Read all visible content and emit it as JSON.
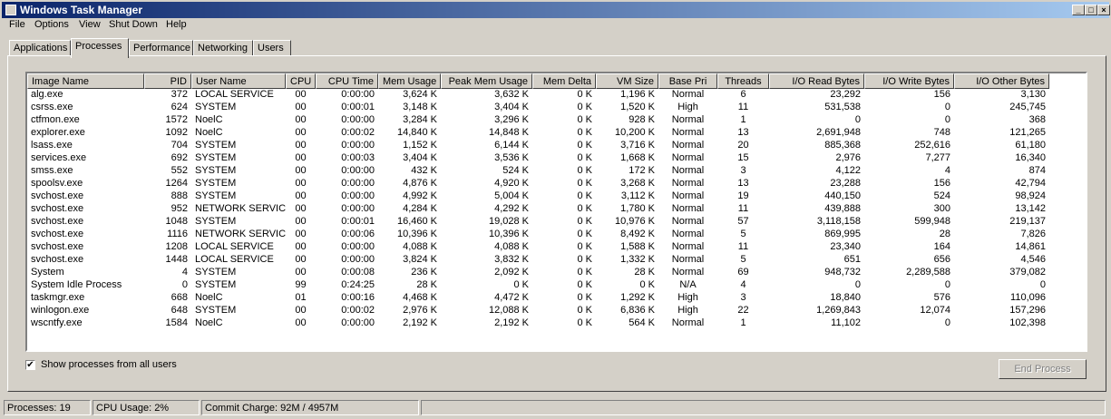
{
  "window": {
    "title": "Windows Task Manager"
  },
  "menu": [
    "File",
    "Options",
    "View",
    "Shut Down",
    "Help"
  ],
  "tabs": [
    "Applications",
    "Processes",
    "Performance",
    "Networking",
    "Users"
  ],
  "active_tab": "Processes",
  "columns": [
    "Image Name",
    "PID",
    "User Name",
    "CPU",
    "CPU Time",
    "Mem Usage",
    "Peak Mem Usage",
    "Mem Delta",
    "VM Size",
    "Base Pri",
    "Threads",
    "I/O Read Bytes",
    "I/O Write Bytes",
    "I/O Other Bytes"
  ],
  "processes": [
    [
      "alg.exe",
      "372",
      "LOCAL SERVICE",
      "00",
      "0:00:00",
      "3,624 K",
      "3,632 K",
      "0 K",
      "1,196 K",
      "Normal",
      "6",
      "23,292",
      "156",
      "3,130"
    ],
    [
      "csrss.exe",
      "624",
      "SYSTEM",
      "00",
      "0:00:01",
      "3,148 K",
      "3,404 K",
      "0 K",
      "1,520 K",
      "High",
      "11",
      "531,538",
      "0",
      "245,745"
    ],
    [
      "ctfmon.exe",
      "1572",
      "NoelC",
      "00",
      "0:00:00",
      "3,284 K",
      "3,296 K",
      "0 K",
      "928 K",
      "Normal",
      "1",
      "0",
      "0",
      "368"
    ],
    [
      "explorer.exe",
      "1092",
      "NoelC",
      "00",
      "0:00:02",
      "14,840 K",
      "14,848 K",
      "0 K",
      "10,200 K",
      "Normal",
      "13",
      "2,691,948",
      "748",
      "121,265"
    ],
    [
      "lsass.exe",
      "704",
      "SYSTEM",
      "00",
      "0:00:00",
      "1,152 K",
      "6,144 K",
      "0 K",
      "3,716 K",
      "Normal",
      "20",
      "885,368",
      "252,616",
      "61,180"
    ],
    [
      "services.exe",
      "692",
      "SYSTEM",
      "00",
      "0:00:03",
      "3,404 K",
      "3,536 K",
      "0 K",
      "1,668 K",
      "Normal",
      "15",
      "2,976",
      "7,277",
      "16,340"
    ],
    [
      "smss.exe",
      "552",
      "SYSTEM",
      "00",
      "0:00:00",
      "432 K",
      "524 K",
      "0 K",
      "172 K",
      "Normal",
      "3",
      "4,122",
      "4",
      "874"
    ],
    [
      "spoolsv.exe",
      "1264",
      "SYSTEM",
      "00",
      "0:00:00",
      "4,876 K",
      "4,920 K",
      "0 K",
      "3,268 K",
      "Normal",
      "13",
      "23,288",
      "156",
      "42,794"
    ],
    [
      "svchost.exe",
      "888",
      "SYSTEM",
      "00",
      "0:00:00",
      "4,992 K",
      "5,004 K",
      "0 K",
      "3,112 K",
      "Normal",
      "19",
      "440,150",
      "524",
      "98,924"
    ],
    [
      "svchost.exe",
      "952",
      "NETWORK SERVICE",
      "00",
      "0:00:00",
      "4,284 K",
      "4,292 K",
      "0 K",
      "1,780 K",
      "Normal",
      "11",
      "439,888",
      "300",
      "13,142"
    ],
    [
      "svchost.exe",
      "1048",
      "SYSTEM",
      "00",
      "0:00:01",
      "16,460 K",
      "19,028 K",
      "0 K",
      "10,976 K",
      "Normal",
      "57",
      "3,118,158",
      "599,948",
      "219,137"
    ],
    [
      "svchost.exe",
      "1116",
      "NETWORK SERVICE",
      "00",
      "0:00:06",
      "10,396 K",
      "10,396 K",
      "0 K",
      "8,492 K",
      "Normal",
      "5",
      "869,995",
      "28",
      "7,826"
    ],
    [
      "svchost.exe",
      "1208",
      "LOCAL SERVICE",
      "00",
      "0:00:00",
      "4,088 K",
      "4,088 K",
      "0 K",
      "1,588 K",
      "Normal",
      "11",
      "23,340",
      "164",
      "14,861"
    ],
    [
      "svchost.exe",
      "1448",
      "LOCAL SERVICE",
      "00",
      "0:00:00",
      "3,824 K",
      "3,832 K",
      "0 K",
      "1,332 K",
      "Normal",
      "5",
      "651",
      "656",
      "4,546"
    ],
    [
      "System",
      "4",
      "SYSTEM",
      "00",
      "0:00:08",
      "236 K",
      "2,092 K",
      "0 K",
      "28 K",
      "Normal",
      "69",
      "948,732",
      "2,289,588",
      "379,082"
    ],
    [
      "System Idle Process",
      "0",
      "SYSTEM",
      "99",
      "0:24:25",
      "28 K",
      "0 K",
      "0 K",
      "0 K",
      "N/A",
      "4",
      "0",
      "0",
      "0"
    ],
    [
      "taskmgr.exe",
      "668",
      "NoelC",
      "01",
      "0:00:16",
      "4,468 K",
      "4,472 K",
      "0 K",
      "1,292 K",
      "High",
      "3",
      "18,840",
      "576",
      "110,096"
    ],
    [
      "winlogon.exe",
      "648",
      "SYSTEM",
      "00",
      "0:00:02",
      "2,976 K",
      "12,088 K",
      "0 K",
      "6,836 K",
      "High",
      "22",
      "1,269,843",
      "12,074",
      "157,296"
    ],
    [
      "wscntfy.exe",
      "1584",
      "NoelC",
      "00",
      "0:00:00",
      "2,192 K",
      "2,192 K",
      "0 K",
      "564 K",
      "Normal",
      "1",
      "11,102",
      "0",
      "102,398"
    ]
  ],
  "show_all_users": {
    "label": "Show processes from all users",
    "checked": true
  },
  "end_process_label": "End Process",
  "status": {
    "processes": "Processes: 19",
    "cpu": "CPU Usage: 2%",
    "commit": "Commit Charge: 92M / 4957M"
  }
}
